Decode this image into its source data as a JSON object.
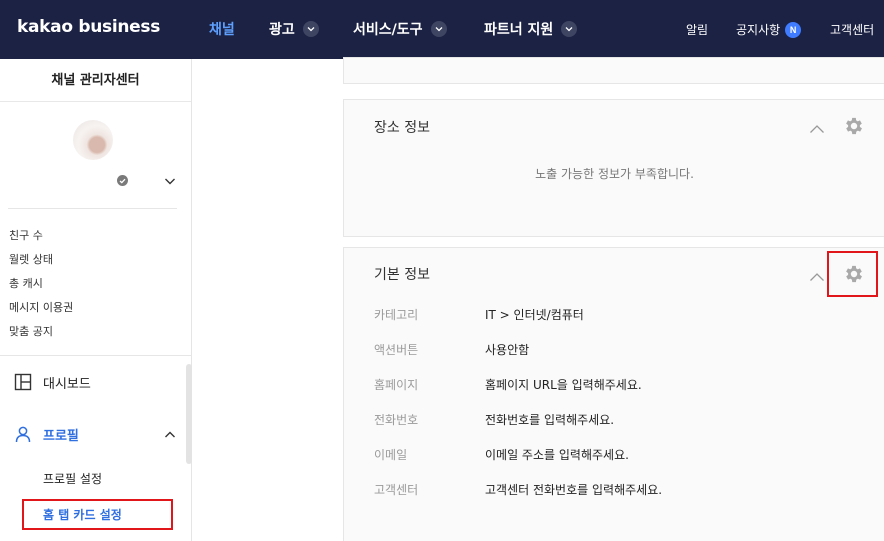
{
  "header": {
    "logo": "kakao business",
    "nav": [
      {
        "label": "채널",
        "active": true,
        "dropdown": false
      },
      {
        "label": "광고",
        "active": false,
        "dropdown": true
      },
      {
        "label": "서비스/도구",
        "active": false,
        "dropdown": true
      },
      {
        "label": "파트너 지원",
        "active": false,
        "dropdown": true
      }
    ],
    "utilities": {
      "alerts": "알림",
      "notices": "공지사항",
      "notices_badge": "N",
      "support": "고객센터"
    }
  },
  "sidebar": {
    "title": "채널 관리자센터",
    "stats": [
      "친구 수",
      "월렛 상태",
      "총 캐시",
      "메시지 이용권",
      "맞춤 공지"
    ],
    "menu": {
      "dashboard": "대시보드",
      "profile": "프로필",
      "profile_sub": [
        "프로필 설정",
        "홈 탭 카드 설정"
      ]
    }
  },
  "main": {
    "location_card": {
      "title": "장소 정보",
      "empty_message": "노출 가능한 정보가 부족합니다."
    },
    "basic_card": {
      "title": "기본 정보",
      "rows": [
        {
          "key": "카테고리",
          "value": "IT > 인터넷/컴퓨터"
        },
        {
          "key": "액션버튼",
          "value": "사용안함"
        },
        {
          "key": "홈페이지",
          "value": "홈페이지 URL을 입력해주세요."
        },
        {
          "key": "전화번호",
          "value": "전화번호를 입력해주세요."
        },
        {
          "key": "이메일",
          "value": "이메일 주소를 입력해주세요."
        },
        {
          "key": "고객센터",
          "value": "고객센터 전화번호를 입력해주세요."
        }
      ]
    }
  },
  "icons": {
    "dropdown": "chevron-down-icon",
    "verified": "check-circle-icon",
    "dashboard": "layout-panel-icon",
    "profile": "person-icon",
    "settings": "gear-icon",
    "collapse": "chevron-up-icon"
  },
  "colors": {
    "topbar": "#1c2244",
    "nav_active": "#5ea0ff",
    "accent": "#2f6fe0",
    "badge": "#3f7cff",
    "highlight": "#e0161b"
  }
}
